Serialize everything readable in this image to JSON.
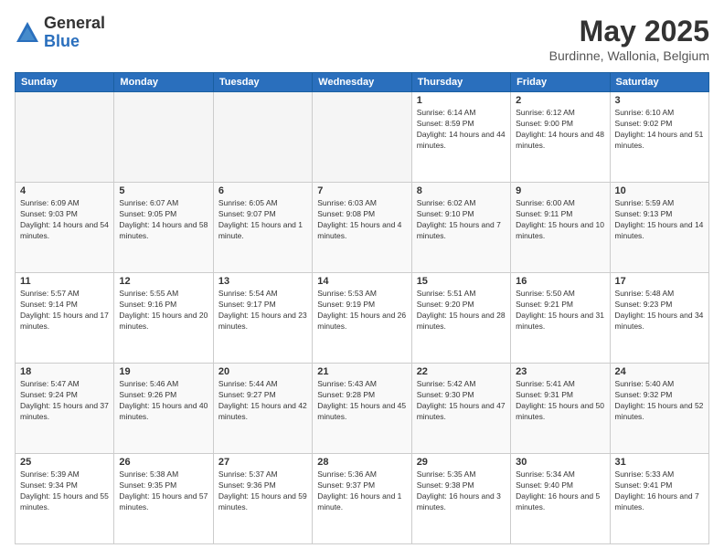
{
  "header": {
    "logo_general": "General",
    "logo_blue": "Blue",
    "month": "May 2025",
    "location": "Burdinne, Wallonia, Belgium"
  },
  "days_of_week": [
    "Sunday",
    "Monday",
    "Tuesday",
    "Wednesday",
    "Thursday",
    "Friday",
    "Saturday"
  ],
  "weeks": [
    [
      {
        "day": "",
        "empty": true
      },
      {
        "day": "",
        "empty": true
      },
      {
        "day": "",
        "empty": true
      },
      {
        "day": "",
        "empty": true
      },
      {
        "day": "1",
        "sunrise": "6:14 AM",
        "sunset": "8:59 PM",
        "daylight": "14 hours and 44 minutes."
      },
      {
        "day": "2",
        "sunrise": "6:12 AM",
        "sunset": "9:00 PM",
        "daylight": "14 hours and 48 minutes."
      },
      {
        "day": "3",
        "sunrise": "6:10 AM",
        "sunset": "9:02 PM",
        "daylight": "14 hours and 51 minutes."
      }
    ],
    [
      {
        "day": "4",
        "sunrise": "6:09 AM",
        "sunset": "9:03 PM",
        "daylight": "14 hours and 54 minutes."
      },
      {
        "day": "5",
        "sunrise": "6:07 AM",
        "sunset": "9:05 PM",
        "daylight": "14 hours and 58 minutes."
      },
      {
        "day": "6",
        "sunrise": "6:05 AM",
        "sunset": "9:07 PM",
        "daylight": "15 hours and 1 minute."
      },
      {
        "day": "7",
        "sunrise": "6:03 AM",
        "sunset": "9:08 PM",
        "daylight": "15 hours and 4 minutes."
      },
      {
        "day": "8",
        "sunrise": "6:02 AM",
        "sunset": "9:10 PM",
        "daylight": "15 hours and 7 minutes."
      },
      {
        "day": "9",
        "sunrise": "6:00 AM",
        "sunset": "9:11 PM",
        "daylight": "15 hours and 10 minutes."
      },
      {
        "day": "10",
        "sunrise": "5:59 AM",
        "sunset": "9:13 PM",
        "daylight": "15 hours and 14 minutes."
      }
    ],
    [
      {
        "day": "11",
        "sunrise": "5:57 AM",
        "sunset": "9:14 PM",
        "daylight": "15 hours and 17 minutes."
      },
      {
        "day": "12",
        "sunrise": "5:55 AM",
        "sunset": "9:16 PM",
        "daylight": "15 hours and 20 minutes."
      },
      {
        "day": "13",
        "sunrise": "5:54 AM",
        "sunset": "9:17 PM",
        "daylight": "15 hours and 23 minutes."
      },
      {
        "day": "14",
        "sunrise": "5:53 AM",
        "sunset": "9:19 PM",
        "daylight": "15 hours and 26 minutes."
      },
      {
        "day": "15",
        "sunrise": "5:51 AM",
        "sunset": "9:20 PM",
        "daylight": "15 hours and 28 minutes."
      },
      {
        "day": "16",
        "sunrise": "5:50 AM",
        "sunset": "9:21 PM",
        "daylight": "15 hours and 31 minutes."
      },
      {
        "day": "17",
        "sunrise": "5:48 AM",
        "sunset": "9:23 PM",
        "daylight": "15 hours and 34 minutes."
      }
    ],
    [
      {
        "day": "18",
        "sunrise": "5:47 AM",
        "sunset": "9:24 PM",
        "daylight": "15 hours and 37 minutes."
      },
      {
        "day": "19",
        "sunrise": "5:46 AM",
        "sunset": "9:26 PM",
        "daylight": "15 hours and 40 minutes."
      },
      {
        "day": "20",
        "sunrise": "5:44 AM",
        "sunset": "9:27 PM",
        "daylight": "15 hours and 42 minutes."
      },
      {
        "day": "21",
        "sunrise": "5:43 AM",
        "sunset": "9:28 PM",
        "daylight": "15 hours and 45 minutes."
      },
      {
        "day": "22",
        "sunrise": "5:42 AM",
        "sunset": "9:30 PM",
        "daylight": "15 hours and 47 minutes."
      },
      {
        "day": "23",
        "sunrise": "5:41 AM",
        "sunset": "9:31 PM",
        "daylight": "15 hours and 50 minutes."
      },
      {
        "day": "24",
        "sunrise": "5:40 AM",
        "sunset": "9:32 PM",
        "daylight": "15 hours and 52 minutes."
      }
    ],
    [
      {
        "day": "25",
        "sunrise": "5:39 AM",
        "sunset": "9:34 PM",
        "daylight": "15 hours and 55 minutes."
      },
      {
        "day": "26",
        "sunrise": "5:38 AM",
        "sunset": "9:35 PM",
        "daylight": "15 hours and 57 minutes."
      },
      {
        "day": "27",
        "sunrise": "5:37 AM",
        "sunset": "9:36 PM",
        "daylight": "15 hours and 59 minutes."
      },
      {
        "day": "28",
        "sunrise": "5:36 AM",
        "sunset": "9:37 PM",
        "daylight": "16 hours and 1 minute."
      },
      {
        "day": "29",
        "sunrise": "5:35 AM",
        "sunset": "9:38 PM",
        "daylight": "16 hours and 3 minutes."
      },
      {
        "day": "30",
        "sunrise": "5:34 AM",
        "sunset": "9:40 PM",
        "daylight": "16 hours and 5 minutes."
      },
      {
        "day": "31",
        "sunrise": "5:33 AM",
        "sunset": "9:41 PM",
        "daylight": "16 hours and 7 minutes."
      }
    ]
  ]
}
